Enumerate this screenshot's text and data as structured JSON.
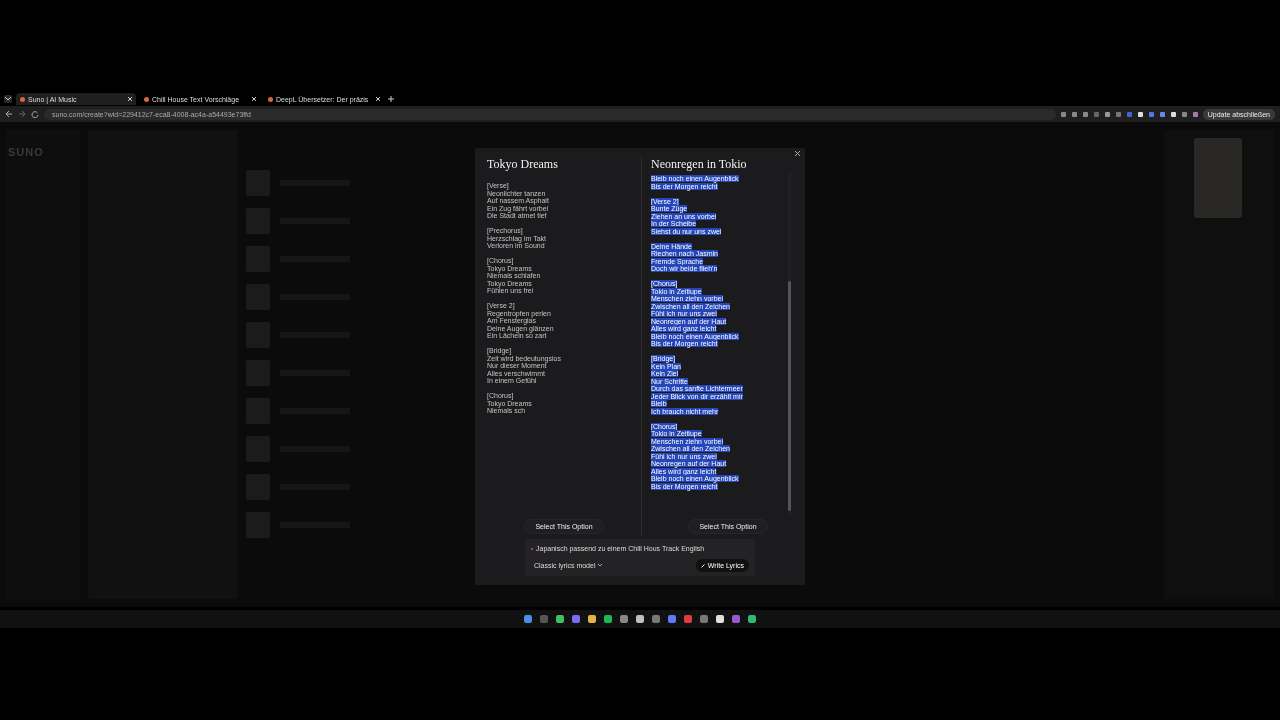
{
  "browser": {
    "tabs": [
      {
        "title": "Suno | AI Music",
        "selected": true
      },
      {
        "title": "Chill House Text Vorschläge",
        "selected": false
      },
      {
        "title": "DeepL Übersetzer: Der präzis",
        "selected": false
      }
    ],
    "url": "suno.com/create?wid=229412c7-eca8-4008-ac4a-a54493e73ffd",
    "update_button": "Update abschließen"
  },
  "app": {
    "logo": "SUNO"
  },
  "dialog": {
    "columns": [
      {
        "title": "Tokyo Dreams",
        "selected": false,
        "stanzas": [
          [
            "[Verse]",
            "Neonlichter tanzen",
            "Auf nassem Asphalt",
            "Ein Zug fährt vorbei",
            "Die Stadt atmet tief"
          ],
          [
            "[Prechorus]",
            "Herzschlag im Takt",
            "Verloren im Sound"
          ],
          [
            "[Chorus]",
            "Tokyo Dreams",
            "Niemals schlafen",
            "Tokyo Dreams",
            "Fühlen uns frei"
          ],
          [
            "[Verse 2]",
            "Regentropfen perlen",
            "Am Fensterglas",
            "Deine Augen glänzen",
            "Ein Lächeln so zart"
          ],
          [
            "[Bridge]",
            "Zeit wird bedeutungslos",
            "Nur dieser Moment",
            "Alles verschwimmt",
            "In einem Gefühl"
          ],
          [
            "[Chorus]",
            "Tokyo Dreams",
            "Niemals sch"
          ]
        ],
        "button": "Select This Option"
      },
      {
        "title": "Neonregen in Tokio",
        "selected": true,
        "scrolled": true,
        "stanzas": [
          [
            "Bleib noch einen Augenblick",
            "Bis der Morgen reicht"
          ],
          [
            "[Verse 2]",
            "Bunte Züge",
            "Ziehen an uns vorbei",
            "In der Scheibe",
            "Siehst du nur uns zwei"
          ],
          [
            "Deine Hände",
            "Riechen nach Jasmin",
            "Fremde Sprache",
            "Doch wir beide flieh'n"
          ],
          [
            "[Chorus]",
            "Tokio in Zeitlupe",
            "Menschen ziehn vorbei",
            "Zwischen all den Zeichen",
            "Fühl ich nur uns zwei",
            "Neonregen auf der Haut",
            "Alles wird ganz leicht",
            "Bleib noch einen Augenblick",
            "Bis der Morgen reicht"
          ],
          [
            "[Bridge]",
            "Kein Plan",
            "Kein Ziel",
            "Nur Schritte",
            "Durch das sanfte Lichtermeer",
            "Jeder Blick von dir erzählt mir",
            "Bleib",
            "Ich brauch nicht mehr"
          ],
          [
            "[Chorus]",
            "Tokio in Zeitlupe",
            "Menschen ziehn vorbei",
            "Zwischen all den Zeichen",
            "Fühl ich nur uns zwei",
            "Neonregen auf der Haut",
            "Alles wird ganz leicht",
            "Bleib noch einen Augenblick",
            "Bis der Morgen reicht"
          ]
        ],
        "button": "Select This Option"
      }
    ],
    "prompt": "Japanisch passend zu einem Chill Hous Track English",
    "model": "Classic lyrics model",
    "write_button": "Write Lyrics"
  }
}
